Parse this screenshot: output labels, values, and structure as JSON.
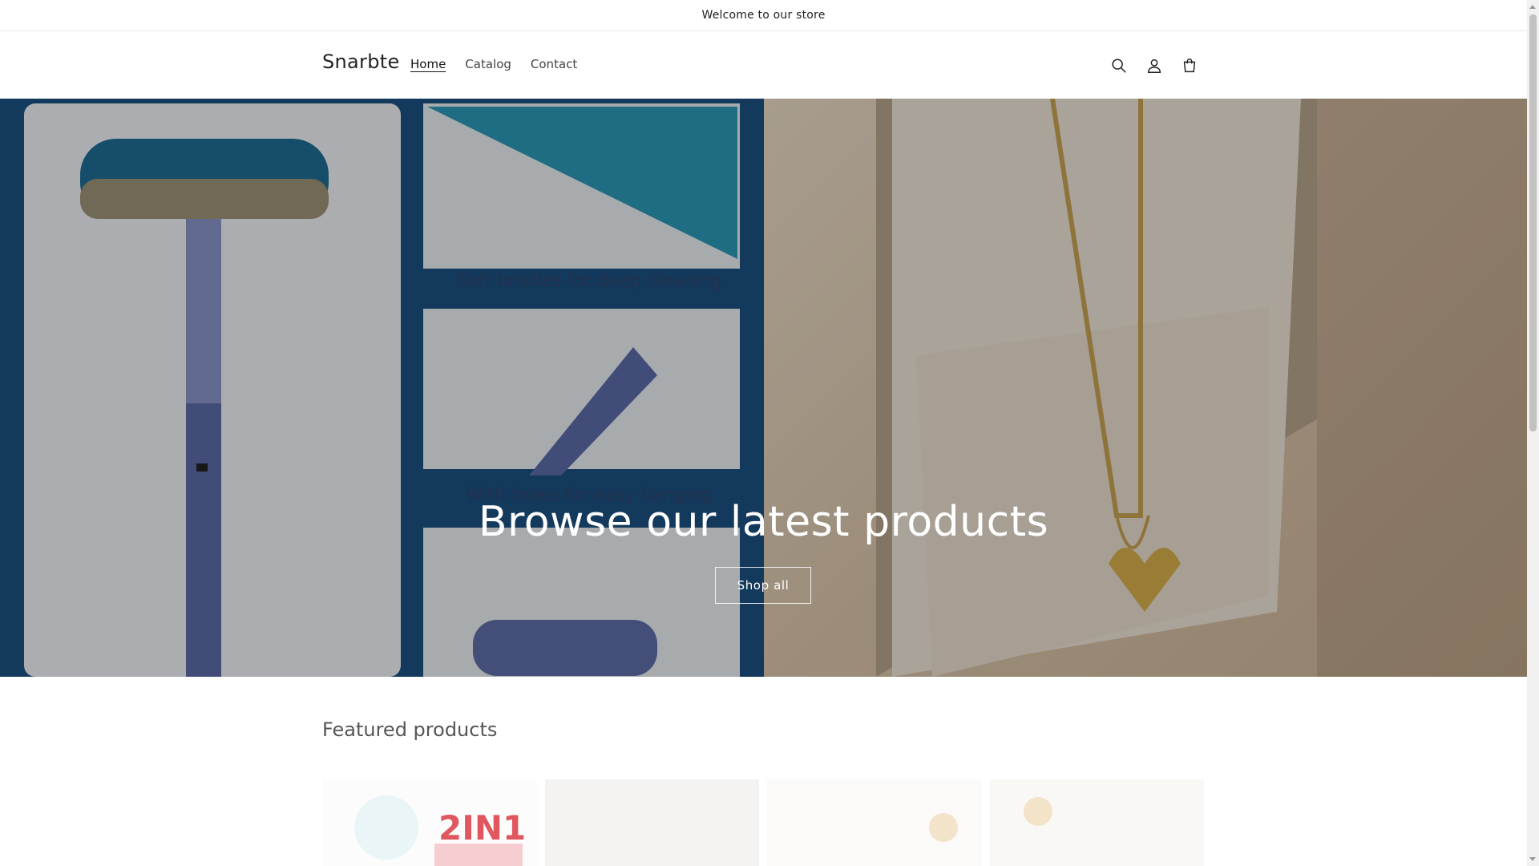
{
  "announcement": {
    "text": "Welcome to our store"
  },
  "header": {
    "logo": "Snarbte",
    "nav": [
      {
        "label": "Home",
        "active": true
      },
      {
        "label": "Catalog",
        "active": false
      },
      {
        "label": "Contact",
        "active": false
      }
    ],
    "icons": [
      "search-icon",
      "account-icon",
      "cart-icon"
    ]
  },
  "hero": {
    "title": "Browse our latest products",
    "button_label": "Shop all",
    "left_image_texts": [
      "Soft bristles for deep cleaning",
      "With holes for easy hanging"
    ]
  },
  "featured": {
    "title": "Featured products",
    "products": [
      {
        "badge": "2IN1"
      },
      {
        "badge": ""
      },
      {
        "badge": ""
      },
      {
        "badge": ""
      }
    ]
  },
  "colors": {
    "hero_left_bg": "#1b4f80",
    "hero_right_bg": "#d9c4aa",
    "text": "#121212"
  }
}
